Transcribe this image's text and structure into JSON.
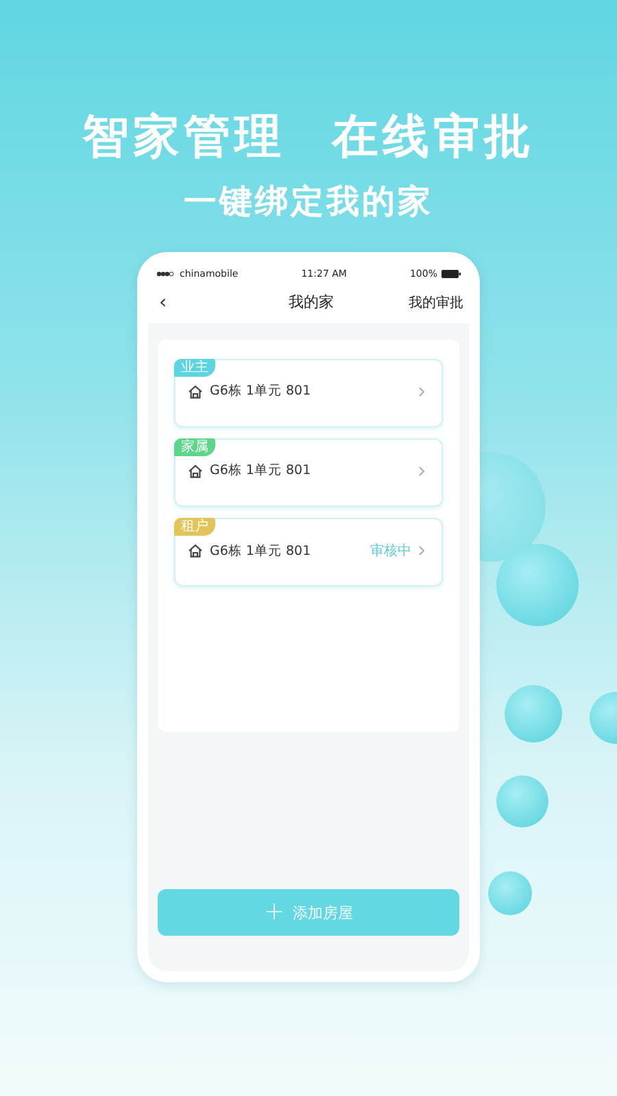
{
  "headline": [
    "智家管理",
    "在线审批"
  ],
  "subtitle": "一键绑定我的家",
  "status_bar": {
    "carrier": "chinamobile",
    "time": "11:27 AM",
    "battery": "100%"
  },
  "nav": {
    "back": "‹",
    "title": "我的家",
    "action": "我的审批"
  },
  "houses": [
    {
      "tag": "业主",
      "color": "#5dd5e0",
      "address": "G6栋 1单元 801"
    },
    {
      "tag": "家属",
      "color": "#5bd68a",
      "address": "G6栋 1单元 801"
    },
    {
      "tag": "租户",
      "color": "#e2c45a",
      "address": "G6栋 1单元 801",
      "status": "审核中"
    }
  ],
  "add_button": {
    "icon": "+",
    "label": "添加房屋"
  }
}
